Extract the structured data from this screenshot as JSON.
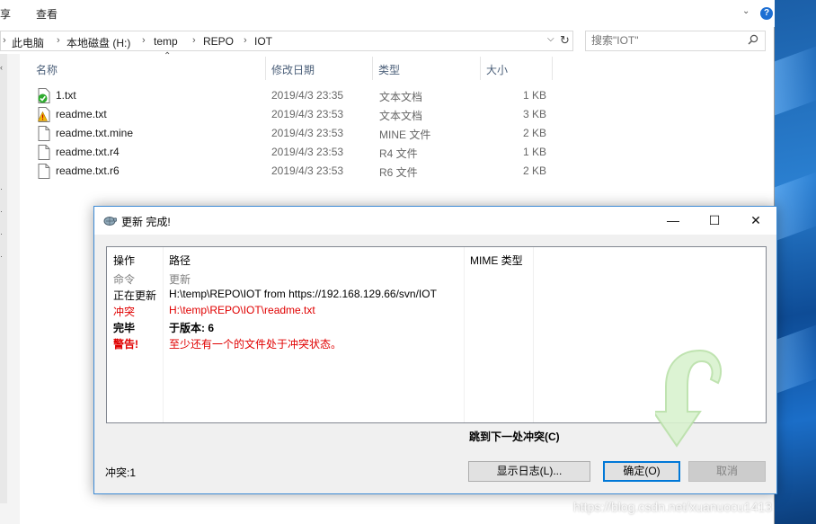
{
  "ribbon": {
    "tab1": "享",
    "tab2": "查看"
  },
  "address": {
    "crumbs": [
      "此电脑",
      "本地磁盘 (H:)",
      "temp",
      "REPO",
      "IOT"
    ],
    "search_placeholder": "搜索\"IOT\""
  },
  "columns": {
    "name": "名称",
    "date": "修改日期",
    "type": "类型",
    "size": "大小"
  },
  "files": [
    {
      "name": "1.txt",
      "date": "2019/4/3 23:35",
      "type": "文本文档",
      "size": "1 KB",
      "icon": "svn-normal-file-icon"
    },
    {
      "name": "readme.txt",
      "date": "2019/4/3 23:53",
      "type": "文本文档",
      "size": "3 KB",
      "icon": "svn-conflict-file-icon"
    },
    {
      "name": "readme.txt.mine",
      "date": "2019/4/3 23:53",
      "type": "MINE 文件",
      "size": "2 KB",
      "icon": "file-icon"
    },
    {
      "name": "readme.txt.r4",
      "date": "2019/4/3 23:53",
      "type": "R4 文件",
      "size": "1 KB",
      "icon": "file-icon"
    },
    {
      "name": "readme.txt.r6",
      "date": "2019/4/3 23:53",
      "type": "R6 文件",
      "size": "2 KB",
      "icon": "file-icon"
    }
  ],
  "dialog": {
    "title": "更新 完成!",
    "headers": {
      "action": "操作",
      "path": "路径",
      "mime": "MIME 类型"
    },
    "rows": [
      {
        "action": "命令",
        "path": "更新",
        "style": "gray"
      },
      {
        "action": "正在更新",
        "path": "H:\\temp\\REPO\\IOT from https://192.168.129.66/svn/IOT",
        "style": "normal"
      },
      {
        "action": "冲突",
        "path": "H:\\temp\\REPO\\IOT\\readme.txt",
        "style": "red"
      },
      {
        "action": "完毕",
        "path": "于版本: 6",
        "style": "bold"
      },
      {
        "action": "警告!",
        "path": "至少还有一个的文件处于冲突状态。",
        "style": "redbold"
      }
    ],
    "jump_label": "跳到下一处冲突(C)",
    "conflicts_label": "冲突:1",
    "buttons": {
      "show_log": "显示日志(L)...",
      "ok": "确定(O)",
      "cancel": "取消"
    }
  },
  "colors": {
    "red": "#e00000",
    "gray": "#808080",
    "accent": "#0078d7"
  },
  "watermark_url": "https://blog.csdn.net/xuanuocu1413"
}
